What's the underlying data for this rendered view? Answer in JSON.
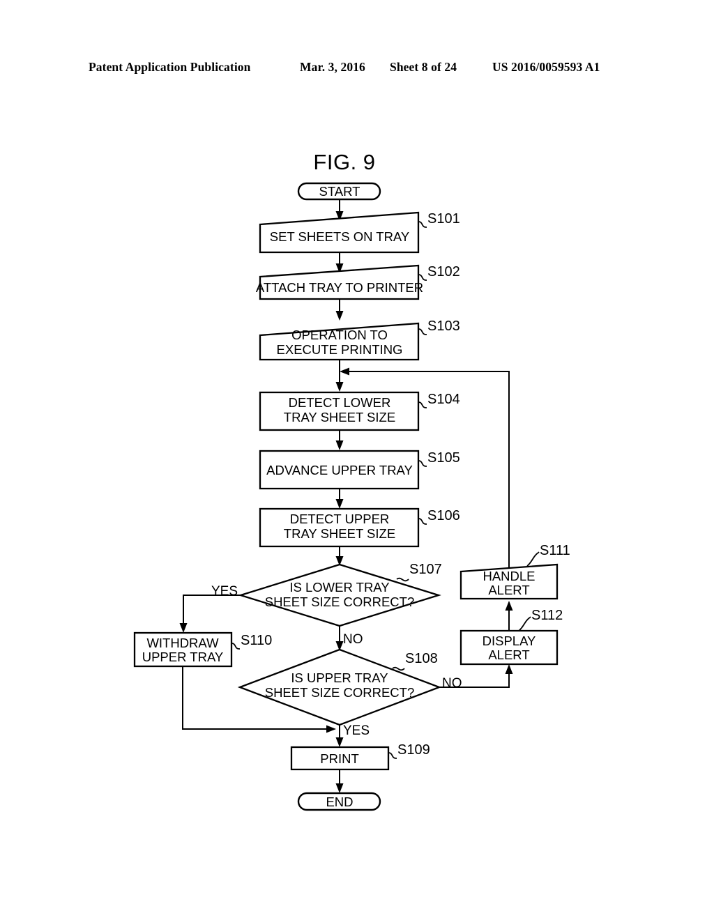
{
  "header": {
    "publication": "Patent Application Publication",
    "date": "Mar. 3, 2016",
    "sheet": "Sheet 8 of 24",
    "patent_number": "US 2016/0059593 A1"
  },
  "figure": {
    "title": "FIG. 9",
    "type": "flowchart",
    "terminals": {
      "start": "START",
      "end": "END"
    },
    "nodes": [
      {
        "id": "S101",
        "ref": "S101",
        "label": "SET SHEETS ON TRAY",
        "shape": "slanted-box"
      },
      {
        "id": "S102",
        "ref": "S102",
        "label": "ATTACH TRAY TO PRINTER",
        "shape": "slanted-box"
      },
      {
        "id": "S103",
        "ref": "S103",
        "label_line1": "OPERATION TO",
        "label_line2": "EXECUTE PRINTING",
        "shape": "slanted-box"
      },
      {
        "id": "S104",
        "ref": "S104",
        "label_line1": "DETECT LOWER",
        "label_line2": "TRAY SHEET SIZE",
        "shape": "box"
      },
      {
        "id": "S105",
        "ref": "S105",
        "label": "ADVANCE UPPER TRAY",
        "shape": "box"
      },
      {
        "id": "S106",
        "ref": "S106",
        "label_line1": "DETECT UPPER",
        "label_line2": "TRAY SHEET SIZE",
        "shape": "box"
      },
      {
        "id": "S107",
        "ref": "S107",
        "label_line1": "IS LOWER TRAY",
        "label_line2": "SHEET SIZE CORRECT?",
        "shape": "diamond"
      },
      {
        "id": "S108",
        "ref": "S108",
        "label_line1": "IS UPPER TRAY",
        "label_line2": "SHEET SIZE CORRECT?",
        "shape": "diamond"
      },
      {
        "id": "S109",
        "ref": "S109",
        "label": "PRINT",
        "shape": "box"
      },
      {
        "id": "S110",
        "ref": "S110",
        "label_line1": "WITHDRAW",
        "label_line2": "UPPER TRAY",
        "shape": "box"
      },
      {
        "id": "S111",
        "ref": "S111",
        "label_line1": "HANDLE",
        "label_line2": "ALERT",
        "shape": "slanted-box"
      },
      {
        "id": "S112",
        "ref": "S112",
        "label_line1": "DISPLAY",
        "label_line2": "ALERT",
        "shape": "box"
      }
    ],
    "branch_labels": {
      "s107_yes": "YES",
      "s107_no": "NO",
      "s108_yes": "YES",
      "s108_no": "NO"
    }
  }
}
